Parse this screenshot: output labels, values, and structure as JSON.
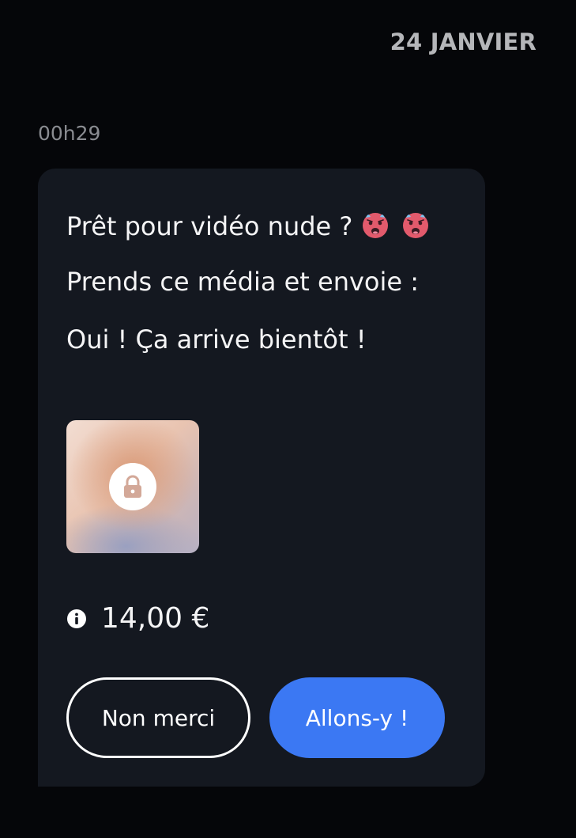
{
  "header": {
    "date": "24 JANVIER"
  },
  "message": {
    "time": "00h29",
    "line1": "Prêt pour vidéo nude ?",
    "line1_emojis": [
      "hot-face-emoji",
      "hot-face-emoji"
    ],
    "line2": "Prends ce média et envoie :",
    "line3": "Oui ! Ça arrive bientôt !",
    "media": {
      "state": "locked",
      "icon": "lock-icon"
    },
    "price": "14,00 €",
    "price_icon": "info-icon",
    "actions": {
      "decline_label": "Non merci",
      "accept_label": "Allons-y !"
    }
  },
  "colors": {
    "background": "#050609",
    "bubble": "#141820",
    "accent": "#3b78f3",
    "text": "#f4f4f5",
    "muted": "#8a8c91"
  }
}
